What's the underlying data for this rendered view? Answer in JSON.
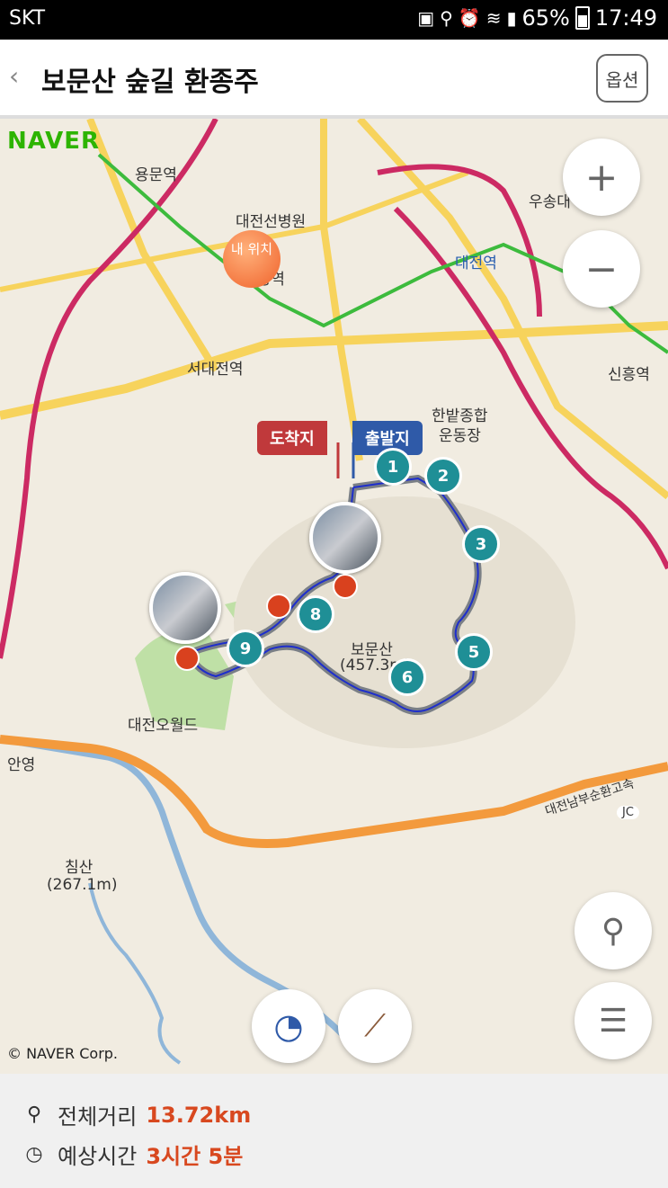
{
  "status_bar": {
    "carrier": "SKT",
    "battery": "65%",
    "time": "17:49"
  },
  "header": {
    "title": "보문산 숲길 환종주",
    "option_label": "옵션"
  },
  "map": {
    "brand": "NAVER",
    "copyright": "© NAVER Corp.",
    "my_location_label": "내 위치",
    "flags": {
      "end": "도착지",
      "start": "출발지"
    },
    "waypoints": [
      "1",
      "2",
      "3",
      "5",
      "6",
      "8",
      "9"
    ],
    "labels": {
      "yongmun": "용문역",
      "hospital": "대전선병원",
      "oryong": "오룡역",
      "seodaejeon": "서대전역",
      "daejeon": "대전역",
      "sinheung": "신흥역",
      "hanbat": "한밭종합",
      "hanbat2": "운동장",
      "bomunsan": "보문산",
      "bomunsan_height": "(457.3m)",
      "daejeon_oworld": "대전오월드",
      "chimsan": "침산",
      "chimsan_height": "(267.1m)",
      "expressway": "대전남부순환고속",
      "jc": "JC",
      "woosong": "우송대",
      "anyeong": "안영"
    }
  },
  "summary": {
    "distance_label": "전체거리",
    "distance_value": "13.72km",
    "time_label": "예상시간",
    "time_value": "3시간 5분"
  }
}
